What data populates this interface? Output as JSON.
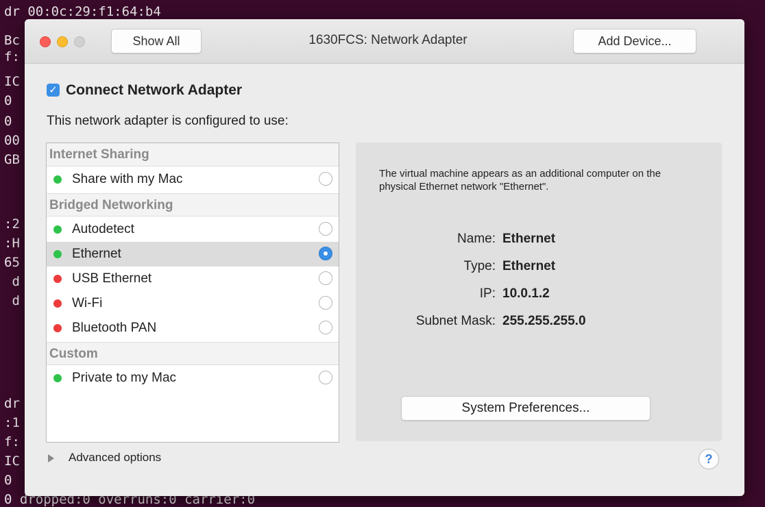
{
  "terminal": {
    "top_line": "dr 00:0c:29:f1:64:b4",
    "left_lines": [
      "Bc",
      "f:",
      "IC",
      "0",
      "0",
      "00",
      "GB",
      "",
      "",
      "",
      ":2",
      ":H",
      "65",
      " d",
      " d",
      "",
      "",
      "",
      "",
      "",
      "",
      "",
      "dr",
      ":1",
      "f:",
      "IC",
      "0"
    ],
    "bottom_line": "0 dropped:0 overruns:0 carrier:0"
  },
  "window": {
    "title": "1630FCS: Network Adapter",
    "show_all_label": "Show All",
    "add_device_label": "Add Device..."
  },
  "connect": {
    "checked": true,
    "check_glyph": "✓",
    "label": "Connect Network Adapter"
  },
  "configured_label": "This network adapter is configured to use:",
  "list": {
    "groups": [
      {
        "label": "Internet Sharing"
      },
      {
        "label": "Bridged Networking"
      },
      {
        "label": "Custom"
      }
    ],
    "rows": [
      {
        "label": "Share with my Mac",
        "status": "green",
        "selected": false
      },
      {
        "label": "Autodetect",
        "status": "green",
        "selected": false
      },
      {
        "label": "Ethernet",
        "status": "green",
        "selected": true
      },
      {
        "label": "USB Ethernet",
        "status": "red",
        "selected": false
      },
      {
        "label": "Wi-Fi",
        "status": "red",
        "selected": false
      },
      {
        "label": "Bluetooth PAN",
        "status": "red",
        "selected": false
      },
      {
        "label": "Private to my Mac",
        "status": "green",
        "selected": false
      }
    ]
  },
  "detail": {
    "description": "The virtual machine appears as an additional computer on the physical Ethernet network \"Ethernet\".",
    "fields": [
      {
        "key": "Name:",
        "value": "Ethernet"
      },
      {
        "key": "Type:",
        "value": "Ethernet"
      },
      {
        "key": "IP:",
        "value": "10.0.1.2"
      },
      {
        "key": "Subnet Mask:",
        "value": "255.255.255.0"
      }
    ],
    "system_prefs_label": "System Preferences..."
  },
  "advanced_label": "Advanced options",
  "help_glyph": "?",
  "colors": {
    "status_green": "#2fc34c",
    "status_red": "#ee3c3c",
    "accent_blue": "#3b8fe5"
  }
}
